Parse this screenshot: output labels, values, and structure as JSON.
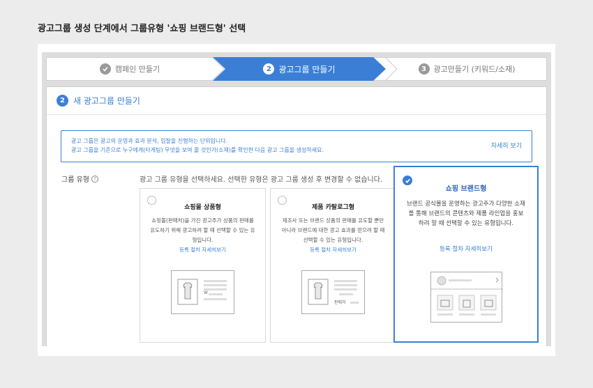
{
  "page_title": "광고그룹 생성 단계에서 그룹유형 '쇼핑 브랜드형' 선택",
  "stepper": {
    "steps": [
      {
        "label": "캠페인 만들기"
      },
      {
        "number": "2",
        "label": "광고그룹 만들기"
      },
      {
        "number": "3",
        "label": "광고만들기 (키워드/소재)"
      }
    ]
  },
  "panel": {
    "number": "2",
    "title": "새 광고그룹 만들기",
    "info_line1": "광고 그룹은 광고의 운영과 효과 분석, 입찰을 진행하는 단위입니다.",
    "info_line2": "광고 그룹을 기준으로 누구에게(타게팅) 무엇을 보여 줄 것인가(소재)를 확인한 다음 광고 그룹을 생성하세요.",
    "info_more": "자세히 보기",
    "group_type_label": "그룹 유형",
    "help_icon": "?",
    "group_type_desc": "광고 그룹 유형을 선택하세요. 선택한 유형은 광고 그룹 생성 후 변경할 수 없습니다."
  },
  "cards": [
    {
      "title": "쇼핑몰 상품형",
      "text": "쇼핑몰(판매처)을 가진 광고주가 상품의 판매를 유도하기 위해 광고하려 할 때 선택할 수 있는 유형입니다.",
      "link": "등록 절차 자세히보기",
      "illo_price": "W"
    },
    {
      "title": "제품 카탈로그형",
      "text": "제조사 또는 브랜드 상품의 판매를 유도할 뿐만 아니라 브랜드에 대한 광고 효과를 얻으려 할 때 선택할 수 있는 유형입니다.",
      "link": "등록 절차 자세히보기",
      "illo_seller": "판매처"
    },
    {
      "title": "쇼핑 브랜드형",
      "text": "브랜드 공식몰을 운영하는 광고주가 다양한 소재를 통해 브랜드의 콘텐츠와 제품 라인업을 홍보하려 할 때 선택할 수 있는 유형입니다.",
      "link": "등록 절차 자세히보기",
      "selected": true
    }
  ],
  "colors": {
    "accent": "#3a7fd5",
    "background": "#ececec"
  },
  "icons": [
    "check-circle-icon",
    "help-icon",
    "radio-icon",
    "shirt-icon",
    "bag-icon",
    "chevron-right-icon"
  ]
}
